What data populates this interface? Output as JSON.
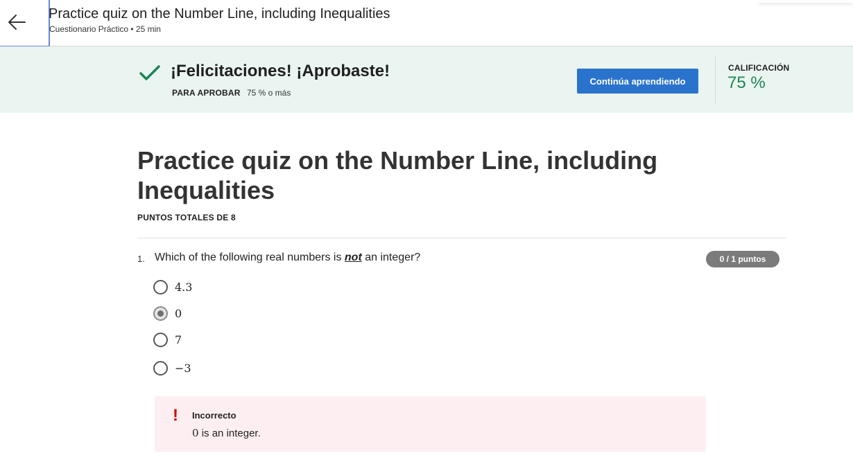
{
  "header": {
    "title": "Practice quiz on the Number Line, including Inequalities",
    "subtitle": "Cuestionario Práctico • 25 min",
    "back_icon": "arrow-left-icon"
  },
  "banner": {
    "title": "¡Felicitaciones! ¡Aprobaste!",
    "pass_label": "PARA APROBAR",
    "pass_value": "75 % o más",
    "continue_label": "Continúa aprendiendo",
    "grade_label": "CALIFICACIÓN",
    "grade_value": "75 %",
    "check_icon": "checkmark-icon",
    "colors": {
      "background": "#eaf5f1",
      "accent": "#1f8354",
      "button": "#2a73cc"
    }
  },
  "quiz": {
    "title": "Practice quiz on the Number Line, including Inequalities",
    "total_points": "PUNTOS TOTALES DE 8"
  },
  "question": {
    "number": "1.",
    "text_before": "Which of the following real numbers is ",
    "text_emphasis": "not",
    "text_after": " an integer?",
    "points": "0 / 1 puntos",
    "options": [
      {
        "label": "4.3",
        "selected": false
      },
      {
        "label": "0",
        "selected": true
      },
      {
        "label": "7",
        "selected": false
      },
      {
        "label": "−3",
        "selected": false
      }
    ],
    "feedback": {
      "icon": "exclamation-icon",
      "title": "Incorrecto",
      "math": "0",
      "text": " is an integer.",
      "colors": {
        "background": "#fdeff1",
        "icon": "#d30000"
      }
    }
  }
}
